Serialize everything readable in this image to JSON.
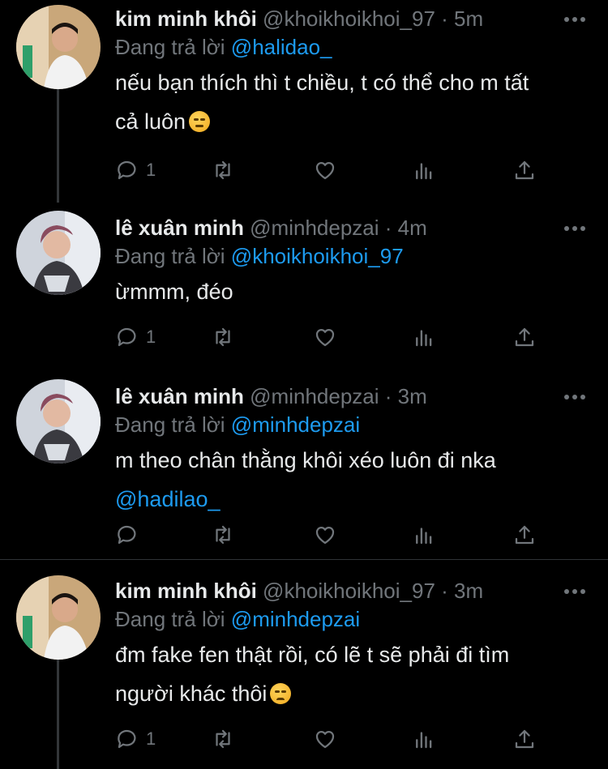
{
  "tweets": [
    {
      "display_name": "kim minh khôi",
      "handle": "@khoikhoikhoi_97",
      "time": "5m",
      "replying_label": "Đang trả lời",
      "replying_to": "@halidao_",
      "text_lines": [
        "nếu bạn thích thì t chiều, t có thể cho m tất",
        "cả luôn"
      ],
      "emoji": "smirking-face-emoji",
      "reply_count": "1",
      "avatar": "avatar-photo"
    },
    {
      "display_name": "lê xuân minh",
      "handle": "@minhdepzai",
      "time": "4m",
      "replying_label": "Đang trả lời",
      "replying_to": "@khoikhoikhoi_97",
      "text_lines": [
        "ừmmm, đéo"
      ],
      "reply_count": "1",
      "avatar": "avatar-photo"
    },
    {
      "display_name": "lê xuân minh",
      "handle": "@minhdepzai",
      "time": "3m",
      "replying_label": "Đang trả lời",
      "replying_to": "@minhdepzai",
      "text_lines": [
        "m theo chân thằng khôi xéo luôn đi nka"
      ],
      "mention_line": "@hadilao_",
      "reply_count": "",
      "avatar": "avatar-photo"
    },
    {
      "display_name": "kim minh khôi",
      "handle": "@khoikhoikhoi_97",
      "time": "3m",
      "replying_label": "Đang trả lời",
      "replying_to": "@minhdepzai",
      "text_lines": [
        "đm fake fen thật rồi, có lẽ t sẽ phải đi tìm",
        "người khác thôi"
      ],
      "emoji": "disappointed-face-emoji",
      "reply_count": "1",
      "avatar": "avatar-photo"
    }
  ],
  "separator": " · ",
  "colors": {
    "background": "#000000",
    "text": "#e7e9ea",
    "muted": "#71767b",
    "link": "#1d9bf0"
  }
}
